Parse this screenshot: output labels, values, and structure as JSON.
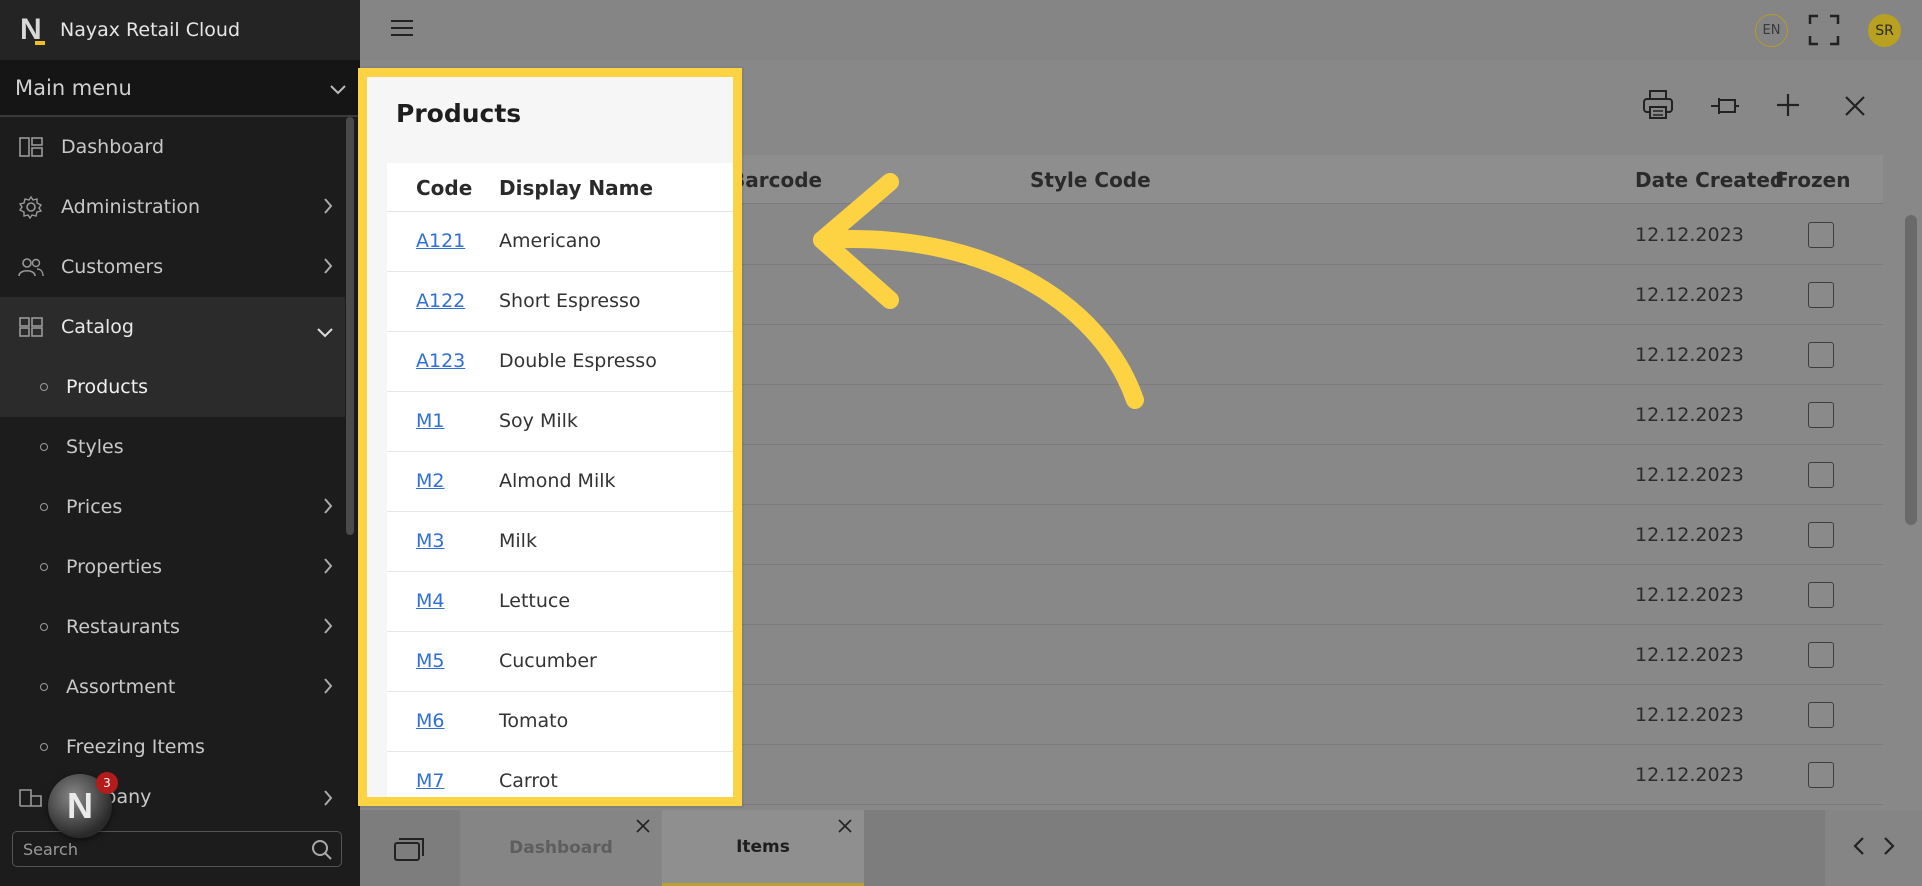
{
  "app": {
    "title": "Nayax Retail Cloud",
    "logo_letter": "N"
  },
  "sidebar": {
    "header": "Main menu",
    "items": [
      {
        "label": "Dashboard",
        "icon": "dashboard-icon",
        "chevron": false
      },
      {
        "label": "Administration",
        "icon": "gear-icon",
        "chevron": true
      },
      {
        "label": "Customers",
        "icon": "users-icon",
        "chevron": true
      },
      {
        "label": "Catalog",
        "icon": "grid-icon",
        "chevron": true,
        "expanded": true
      },
      {
        "label": "Products",
        "sub": true,
        "active": true
      },
      {
        "label": "Styles",
        "sub": true
      },
      {
        "label": "Prices",
        "sub": true,
        "chevron": true
      },
      {
        "label": "Properties",
        "sub": true,
        "chevron": true
      },
      {
        "label": "Restaurants",
        "sub": true,
        "chevron": true
      },
      {
        "label": "Assortment",
        "sub": true,
        "chevron": true
      },
      {
        "label": "Freezing Items",
        "sub": true
      },
      {
        "label": "Company",
        "icon": "building-icon",
        "chevron": true
      }
    ],
    "search_placeholder": "Search",
    "notification_count": "3"
  },
  "topbar": {
    "language": "EN",
    "user_initials": "SR"
  },
  "products_panel": {
    "title": "Products",
    "columns": {
      "code": "Code",
      "display_name": "Display Name"
    },
    "rows": [
      {
        "code": "A121",
        "name": "Americano"
      },
      {
        "code": "A122",
        "name": "Short Espresso"
      },
      {
        "code": "A123",
        "name": "Double Espresso"
      },
      {
        "code": "M1",
        "name": "Soy Milk"
      },
      {
        "code": "M2",
        "name": "Almond Milk"
      },
      {
        "code": "M3",
        "name": "Milk"
      },
      {
        "code": "M4",
        "name": "Lettuce"
      },
      {
        "code": "M5",
        "name": "Cucumber"
      },
      {
        "code": "M6",
        "name": "Tomato"
      },
      {
        "code": "M7",
        "name": "Carrot"
      }
    ]
  },
  "background_table": {
    "columns": {
      "barcode": "Barcode",
      "style_code": "Style Code",
      "date_created": "Date Created",
      "frozen": "Frozen"
    },
    "dates": [
      "12.12.2023",
      "12.12.2023",
      "12.12.2023",
      "12.12.2023",
      "12.12.2023",
      "12.12.2023",
      "12.12.2023",
      "12.12.2023",
      "12.12.2023",
      "12.12.2023"
    ]
  },
  "tabs": [
    {
      "label": "Dashboard",
      "active": false
    },
    {
      "label": "Items",
      "active": true
    }
  ],
  "colors": {
    "highlight": "#fdd344",
    "link": "#2f6fd6",
    "sidebar_bg": "#1c1c1c"
  }
}
